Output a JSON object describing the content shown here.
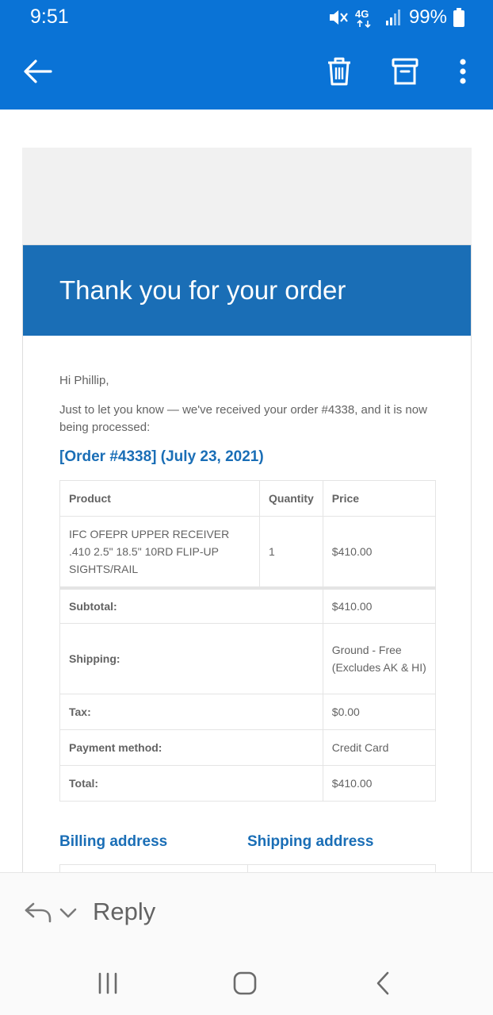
{
  "status_bar": {
    "time": "9:51",
    "network": "4G",
    "battery": "99%"
  },
  "app_bar": {
    "back_icon": "arrow-left-icon",
    "delete_icon": "trash-icon",
    "archive_icon": "archive-icon",
    "more_icon": "more-vertical-icon"
  },
  "email": {
    "header_title": "Thank you for your order",
    "greeting": "Hi Phillip,",
    "intro": "Just to let you know — we've received your order #4338, and it is now being processed:",
    "order_title": "[Order #4338] (July 23, 2021)",
    "table": {
      "headers": [
        "Product",
        "Quantity",
        "Price"
      ],
      "items": [
        {
          "product": "IFC OFEPR UPPER RECEIVER .410 2.5\" 18.5\" 10RD FLIP-UP SIGHTS/RAIL",
          "quantity": "1",
          "price": "$410.00"
        }
      ],
      "totals": [
        {
          "label": "Subtotal:",
          "value": "$410.00"
        },
        {
          "label": "Shipping:",
          "value": "Ground - Free (Excludes AK & HI)"
        },
        {
          "label": "Tax:",
          "value": "$0.00"
        },
        {
          "label": "Payment method:",
          "value": "Credit Card"
        },
        {
          "label": "Total:",
          "value": "$410.00"
        }
      ]
    },
    "billing_title": "Billing address",
    "shipping_title": "Shipping address"
  },
  "reply_bar": {
    "label": "Reply"
  },
  "colors": {
    "app_bar": "#0a73d6",
    "email_header": "#1a6eb6",
    "link_blue": "#1a6eb6",
    "text": "#636363"
  }
}
